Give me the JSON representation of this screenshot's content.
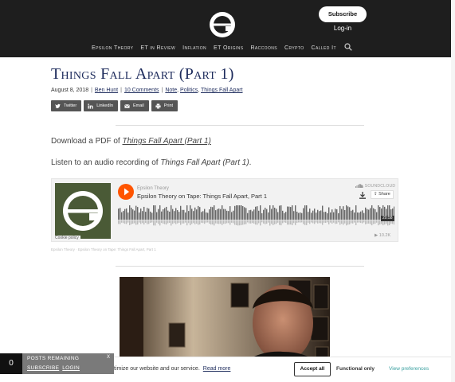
{
  "header": {
    "subscribe_label": "Subscribe",
    "login_label": "Log-in",
    "nav": [
      "Epsilon Theory",
      "ET in Review",
      "Inflation",
      "ET Origins",
      "Raccoons",
      "Crypto",
      "Called It"
    ],
    "search_icon": "search-icon"
  },
  "article": {
    "title": "Things Fall Apart (Part 1)",
    "date": "August 8, 2018",
    "author": "Ben Hunt",
    "comments": "10 Comments",
    "categories": [
      "Note",
      "Politics",
      "Things Fall Apart"
    ],
    "share": [
      "Twitter",
      "LinkedIn",
      "Email",
      "Print"
    ],
    "pdf_prefix": "Download a PDF of ",
    "pdf_link": "Things Fall Apart (Part 1)",
    "audio_prefix": "Listen to an audio recording of ",
    "audio_title": "Things Fall Apart (Part 1)",
    "audio_suffix": "."
  },
  "soundcloud": {
    "user": "Epsilon Theory",
    "track": "Epsilon Theory on Tape: Things Fall Apart, Part 1",
    "brand": "SOUNDCLOUD",
    "share_label": "Share",
    "duration": "20:58",
    "plays": "10.2K",
    "cookie_policy": "Cookie policy",
    "caption": "Epsilon Theory · Epsilon Theory on Tape: Things Fall Apart, Part 1"
  },
  "posts_bar": {
    "count": "0",
    "label": "POSTS REMAINING",
    "subscribe": "SUBSCRIBE",
    "login": "LOGIN",
    "close": "X"
  },
  "cookie_bar": {
    "text": "timize our website and our service.",
    "read_more": "Read more",
    "accept": "Accept all",
    "functional": "Functional only",
    "preferences": "View preferences"
  },
  "colors": {
    "header_bg": "#1e1e1e",
    "title": "#1d2b5c",
    "soundcloud_orange": "#ff5500",
    "art_green": "#4a5a36"
  }
}
